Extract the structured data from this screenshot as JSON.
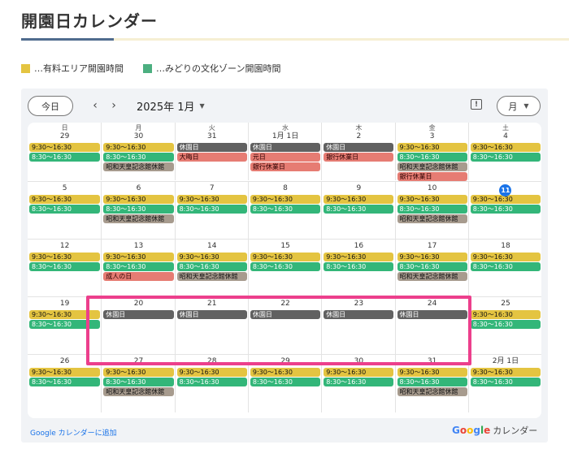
{
  "header": {
    "title": "開園日カレンダー"
  },
  "legend": [
    {
      "label": "…有料エリア開園時間",
      "color": "#e4c441"
    },
    {
      "label": "…みどりの文化ゾーン開園時間",
      "color": "#4caf80"
    }
  ],
  "toolbar": {
    "today_label": "今日",
    "prev_icon": "‹",
    "next_icon": "›",
    "month_label": "2025年 1月",
    "month_caret": "▼",
    "feedback_icon": "!",
    "view_label": "月",
    "view_caret": "▼"
  },
  "weekdays": [
    "日",
    "月",
    "火",
    "水",
    "木",
    "金",
    "土"
  ],
  "weeks": [
    {
      "days": [
        {
          "label": "29",
          "events": [
            {
              "text": "9:30〜16:30",
              "kind": "yellow"
            },
            {
              "text": "8:30〜16:30",
              "kind": "green"
            }
          ]
        },
        {
          "label": "30",
          "events": [
            {
              "text": "9:30〜16:30",
              "kind": "yellow"
            },
            {
              "text": "8:30〜16:30",
              "kind": "green"
            },
            {
              "text": "昭和天皇記念館休館",
              "kind": "taupe"
            }
          ]
        },
        {
          "label": "31",
          "events": [
            {
              "text": "休園日",
              "kind": "gray"
            },
            {
              "text": "大晦日",
              "kind": "red"
            }
          ]
        },
        {
          "label": "1月 1日",
          "events": [
            {
              "text": "休園日",
              "kind": "gray"
            },
            {
              "text": "元日",
              "kind": "red"
            },
            {
              "text": "銀行休業日",
              "kind": "red"
            }
          ]
        },
        {
          "label": "2",
          "events": [
            {
              "text": "休園日",
              "kind": "gray"
            },
            {
              "text": "銀行休業日",
              "kind": "red"
            }
          ]
        },
        {
          "label": "3",
          "events": [
            {
              "text": "9:30〜16:30",
              "kind": "yellow"
            },
            {
              "text": "8:30〜16:30",
              "kind": "green"
            },
            {
              "text": "昭和天皇記念館休館",
              "kind": "taupe"
            },
            {
              "text": "銀行休業日",
              "kind": "red"
            }
          ]
        },
        {
          "label": "4",
          "events": [
            {
              "text": "9:30〜16:30",
              "kind": "yellow"
            },
            {
              "text": "8:30〜16:30",
              "kind": "green"
            }
          ]
        }
      ]
    },
    {
      "days": [
        {
          "label": "5",
          "events": [
            {
              "text": "9:30〜16:30",
              "kind": "yellow"
            },
            {
              "text": "8:30〜16:30",
              "kind": "green"
            }
          ]
        },
        {
          "label": "6",
          "events": [
            {
              "text": "9:30〜16:30",
              "kind": "yellow"
            },
            {
              "text": "8:30〜16:30",
              "kind": "green"
            },
            {
              "text": "昭和天皇記念館休館",
              "kind": "taupe"
            }
          ]
        },
        {
          "label": "7",
          "events": [
            {
              "text": "9:30〜16:30",
              "kind": "yellow"
            },
            {
              "text": "8:30〜16:30",
              "kind": "green"
            }
          ]
        },
        {
          "label": "8",
          "events": [
            {
              "text": "9:30〜16:30",
              "kind": "yellow"
            },
            {
              "text": "8:30〜16:30",
              "kind": "green"
            }
          ]
        },
        {
          "label": "9",
          "events": [
            {
              "text": "9:30〜16:30",
              "kind": "yellow"
            },
            {
              "text": "8:30〜16:30",
              "kind": "green"
            }
          ]
        },
        {
          "label": "10",
          "events": [
            {
              "text": "9:30〜16:30",
              "kind": "yellow"
            },
            {
              "text": "8:30〜16:30",
              "kind": "green"
            },
            {
              "text": "昭和天皇記念館休館",
              "kind": "taupe"
            }
          ]
        },
        {
          "label": "11",
          "today": true,
          "events": [
            {
              "text": "9:30〜16:30",
              "kind": "yellow"
            },
            {
              "text": "8:30〜16:30",
              "kind": "green"
            }
          ]
        }
      ]
    },
    {
      "days": [
        {
          "label": "12",
          "events": [
            {
              "text": "9:30〜16:30",
              "kind": "yellow"
            },
            {
              "text": "8:30〜16:30",
              "kind": "green"
            }
          ]
        },
        {
          "label": "13",
          "events": [
            {
              "text": "9:30〜16:30",
              "kind": "yellow"
            },
            {
              "text": "8:30〜16:30",
              "kind": "green"
            },
            {
              "text": "成人の日",
              "kind": "red"
            }
          ]
        },
        {
          "label": "14",
          "events": [
            {
              "text": "9:30〜16:30",
              "kind": "yellow"
            },
            {
              "text": "8:30〜16:30",
              "kind": "green"
            },
            {
              "text": "昭和天皇記念館休館",
              "kind": "taupe"
            }
          ]
        },
        {
          "label": "15",
          "events": [
            {
              "text": "9:30〜16:30",
              "kind": "yellow"
            },
            {
              "text": "8:30〜16:30",
              "kind": "green"
            }
          ]
        },
        {
          "label": "16",
          "events": [
            {
              "text": "9:30〜16:30",
              "kind": "yellow"
            },
            {
              "text": "8:30〜16:30",
              "kind": "green"
            }
          ]
        },
        {
          "label": "17",
          "events": [
            {
              "text": "9:30〜16:30",
              "kind": "yellow"
            },
            {
              "text": "8:30〜16:30",
              "kind": "green"
            },
            {
              "text": "昭和天皇記念館休館",
              "kind": "taupe"
            }
          ]
        },
        {
          "label": "18",
          "events": [
            {
              "text": "9:30〜16:30",
              "kind": "yellow"
            },
            {
              "text": "8:30〜16:30",
              "kind": "green"
            }
          ]
        }
      ]
    },
    {
      "days": [
        {
          "label": "19",
          "events": [
            {
              "text": "9:30〜16:30",
              "kind": "yellow"
            },
            {
              "text": "8:30〜16:30",
              "kind": "green"
            }
          ]
        },
        {
          "label": "20",
          "events": [
            {
              "text": "休園日",
              "kind": "gray"
            }
          ]
        },
        {
          "label": "21",
          "events": [
            {
              "text": "休園日",
              "kind": "gray"
            }
          ]
        },
        {
          "label": "22",
          "events": [
            {
              "text": "休園日",
              "kind": "gray"
            }
          ]
        },
        {
          "label": "23",
          "events": [
            {
              "text": "休園日",
              "kind": "gray"
            }
          ]
        },
        {
          "label": "24",
          "events": [
            {
              "text": "休園日",
              "kind": "gray"
            }
          ]
        },
        {
          "label": "25",
          "events": [
            {
              "text": "9:30〜16:30",
              "kind": "yellow"
            },
            {
              "text": "8:30〜16:30",
              "kind": "green"
            }
          ]
        }
      ]
    },
    {
      "days": [
        {
          "label": "26",
          "events": [
            {
              "text": "9:30〜16:30",
              "kind": "yellow"
            },
            {
              "text": "8:30〜16:30",
              "kind": "green"
            }
          ]
        },
        {
          "label": "27",
          "events": [
            {
              "text": "9:30〜16:30",
              "kind": "yellow"
            },
            {
              "text": "8:30〜16:30",
              "kind": "green"
            },
            {
              "text": "昭和天皇記念館休館",
              "kind": "taupe"
            }
          ]
        },
        {
          "label": "28",
          "events": [
            {
              "text": "9:30〜16:30",
              "kind": "yellow"
            },
            {
              "text": "8:30〜16:30",
              "kind": "green"
            }
          ]
        },
        {
          "label": "29",
          "events": [
            {
              "text": "9:30〜16:30",
              "kind": "yellow"
            },
            {
              "text": "8:30〜16:30",
              "kind": "green"
            }
          ]
        },
        {
          "label": "30",
          "events": [
            {
              "text": "9:30〜16:30",
              "kind": "yellow"
            },
            {
              "text": "8:30〜16:30",
              "kind": "green"
            }
          ]
        },
        {
          "label": "31",
          "events": [
            {
              "text": "9:30〜16:30",
              "kind": "yellow"
            },
            {
              "text": "8:30〜16:30",
              "kind": "green"
            },
            {
              "text": "昭和天皇記念館休館",
              "kind": "taupe"
            }
          ]
        },
        {
          "label": "2月 1日",
          "events": [
            {
              "text": "9:30〜16:30",
              "kind": "yellow"
            },
            {
              "text": "8:30〜16:30",
              "kind": "green"
            }
          ]
        }
      ]
    }
  ],
  "footer": {
    "add_link": "Google カレンダーに追加",
    "brand_calendar": "カレンダー"
  },
  "colors": {
    "yellow": "#e4c441",
    "green": "#33b679",
    "gray": "#616161",
    "red": "#e67c73",
    "taupe": "#a79b8e",
    "today": "#1a73e8",
    "highlight": "#ec3f8c"
  }
}
